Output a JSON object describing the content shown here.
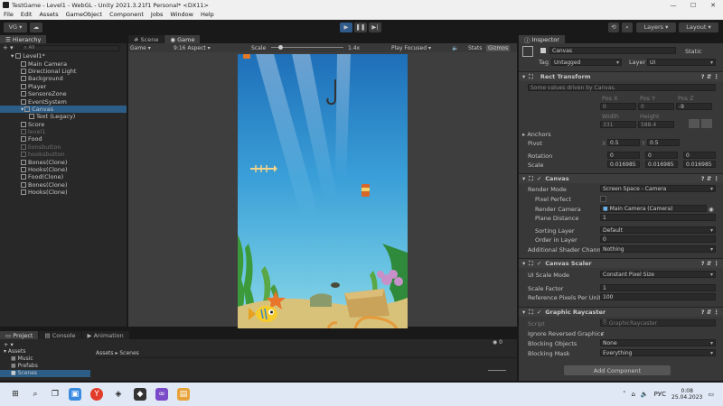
{
  "window": {
    "title": "TestGame - Level1 - WebGL - Unity 2021.3.21f1 Personal* <DX11>",
    "controls": [
      "—",
      "☐",
      "✕"
    ]
  },
  "menu": [
    "File",
    "Edit",
    "Assets",
    "GameObject",
    "Component",
    "Jobs",
    "Window",
    "Help"
  ],
  "toolbar": {
    "account": "VG",
    "layers": "Layers",
    "layout": "Layout"
  },
  "hierarchy": {
    "tab": "Hierarchy",
    "search_placeholder": "All",
    "scene": "Level1*",
    "items": [
      {
        "label": "Main Camera",
        "indent": 1,
        "dim": false
      },
      {
        "label": "Directional Light",
        "indent": 1,
        "dim": false
      },
      {
        "label": "Background",
        "indent": 1,
        "dim": false
      },
      {
        "label": "Player",
        "indent": 1,
        "dim": false
      },
      {
        "label": "SensoreZone",
        "indent": 1,
        "dim": false
      },
      {
        "label": "EventSystem",
        "indent": 1,
        "dim": false
      },
      {
        "label": "Canvas",
        "indent": 1,
        "dim": false,
        "selected": true
      },
      {
        "label": "Text (Legacy)",
        "indent": 2,
        "dim": false
      },
      {
        "label": "Score",
        "indent": 1,
        "dim": false
      },
      {
        "label": "level1",
        "indent": 1,
        "dim": true
      },
      {
        "label": "Food",
        "indent": 1,
        "dim": false
      },
      {
        "label": "lionsbutton",
        "indent": 1,
        "dim": true
      },
      {
        "label": "hooksbutton",
        "indent": 1,
        "dim": true
      },
      {
        "label": "Bones(Clone)",
        "indent": 1,
        "dim": false
      },
      {
        "label": "Hooks(Clone)",
        "indent": 1,
        "dim": false
      },
      {
        "label": "Food(Clone)",
        "indent": 1,
        "dim": false
      },
      {
        "label": "Bones(Clone)",
        "indent": 1,
        "dim": false
      },
      {
        "label": "Hooks(Clone)",
        "indent": 1,
        "dim": false
      }
    ]
  },
  "game": {
    "tab_scene": "Scene",
    "tab_game": "Game",
    "display": "Game",
    "aspect": "9:16 Aspect",
    "scale_label": "Scale",
    "scale_value": "1.4x",
    "play_focused": "Play Focused",
    "stats": "Stats",
    "gizmos": "Gizmos"
  },
  "inspector": {
    "tab": "Inspector",
    "object_name": "Canvas",
    "static_label": "Static",
    "tag_label": "Tag",
    "tag_value": "Untagged",
    "layer_label": "Layer",
    "layer_value": "UI",
    "rect": {
      "title": "Rect Transform",
      "note": "Some values driven by Canvas.",
      "posx_label": "Pos X",
      "posy_label": "Pos Y",
      "posz_label": "Pos Z",
      "posx": "0",
      "posy": "0",
      "posz": "-9",
      "width_label": "Width",
      "height_label": "Height",
      "width": "331",
      "height": "588.4",
      "anchors": "Anchors",
      "pivot": "Pivot",
      "pivot_x": "0.5",
      "pivot_y": "0.5",
      "rotation": "Rotation",
      "rot_x": "0",
      "rot_y": "0",
      "rot_z": "0",
      "scale": "Scale",
      "scale_x": "0.016985",
      "scale_y": "0.016985",
      "scale_z": "0.016985"
    },
    "canvas": {
      "title": "Canvas",
      "render_mode_label": "Render Mode",
      "render_mode": "Screen Space - Camera",
      "pixel_perfect": "Pixel Perfect",
      "render_camera_label": "Render Camera",
      "render_camera": "Main Camera (Camera)",
      "plane_distance_label": "Plane Distance",
      "plane_distance": "1",
      "sorting_layer_label": "Sorting Layer",
      "sorting_layer": "Default",
      "order_label": "Order in Layer",
      "order": "0",
      "shader_label": "Additional Shader Channel",
      "shader": "Nothing"
    },
    "scaler": {
      "title": "Canvas Scaler",
      "mode_label": "UI Scale Mode",
      "mode": "Constant Pixel Size",
      "factor_label": "Scale Factor",
      "factor": "1",
      "ref_label": "Reference Pixels Per Unit",
      "ref": "100"
    },
    "raycaster": {
      "title": "Graphic Raycaster",
      "script_label": "Script",
      "script": "GraphicRaycaster",
      "ignore_label": "Ignore Reversed Graphics",
      "blocking_objects_label": "Blocking Objects",
      "blocking_objects": "None",
      "blocking_mask_label": "Blocking Mask",
      "blocking_mask": "Everything"
    },
    "add_component": "Add Component"
  },
  "project": {
    "tab_project": "Project",
    "tab_console": "Console",
    "tab_animation": "Animation",
    "root": "Assets",
    "folders": [
      "Music",
      "Prefabs",
      "Scenes"
    ],
    "breadcrumb_root": "Assets",
    "breadcrumb_child": "Scenes",
    "count": "0"
  },
  "taskbar": {
    "lang": "РУС",
    "time": "0:08",
    "date": "25.04.2023"
  },
  "colors": {
    "accent": "#2c5d87",
    "play_active": "#2f5a8a",
    "sea_top": "#1e6fb8",
    "sea_bottom": "#7ed0e6"
  }
}
